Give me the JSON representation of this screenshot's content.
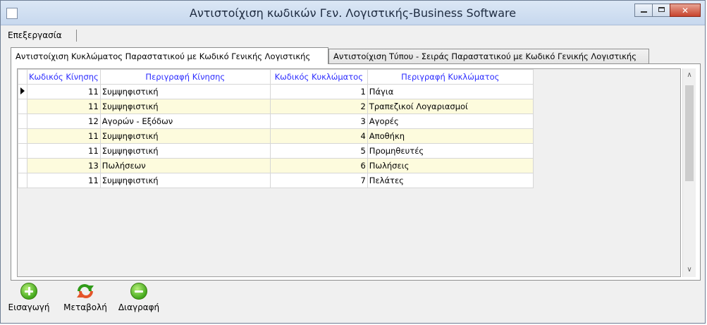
{
  "window": {
    "title": "Αντιστοίχιση κωδικών Γεν. Λογιστικής-Business Software"
  },
  "menu": {
    "items": [
      {
        "label": "Επεξεργασία"
      }
    ]
  },
  "tabs": [
    {
      "label": "Αντιστοίχιση Κυκλώματος Παραστατικού με Κωδικό Γενικής Λογιστικής",
      "active": true
    },
    {
      "label": "Αντιστοίχιση Τύπου - Σειράς Παραστατικού με Κωδικό Γενικής Λογιστικής",
      "active": false
    }
  ],
  "grid": {
    "columns": [
      "Κωδικός Κίνησης",
      "Περιγραφή Κίνησης",
      "Κωδικός Κυκλώματος",
      "Περιγραφή Κυκλώματος"
    ],
    "rows": [
      {
        "move_code": "11",
        "move_desc": "Συμψηφιστική",
        "circuit_code": "1",
        "circuit_desc": "Πάγια"
      },
      {
        "move_code": "11",
        "move_desc": "Συμψηφιστική",
        "circuit_code": "2",
        "circuit_desc": "Τραπεζικοί Λογαριασμοί"
      },
      {
        "move_code": "12",
        "move_desc": "Αγορών - Εξόδων",
        "circuit_code": "3",
        "circuit_desc": "Αγορές"
      },
      {
        "move_code": "11",
        "move_desc": "Συμψηφιστική",
        "circuit_code": "4",
        "circuit_desc": "Αποθήκη"
      },
      {
        "move_code": "11",
        "move_desc": "Συμψηφιστική",
        "circuit_code": "5",
        "circuit_desc": "Προμηθευτές"
      },
      {
        "move_code": "13",
        "move_desc": "Πωλήσεων",
        "circuit_code": "6",
        "circuit_desc": "Πωλήσεις"
      },
      {
        "move_code": "11",
        "move_desc": "Συμψηφιστική",
        "circuit_code": "7",
        "circuit_desc": "Πελάτες"
      }
    ]
  },
  "toolbar": {
    "insert_label": "Εισαγωγή",
    "edit_label": "Μεταβολή",
    "delete_label": "Διαγραφή"
  },
  "icons": {
    "insert": "plus-circle-icon",
    "edit": "refresh-icon",
    "delete": "minus-circle-icon"
  }
}
